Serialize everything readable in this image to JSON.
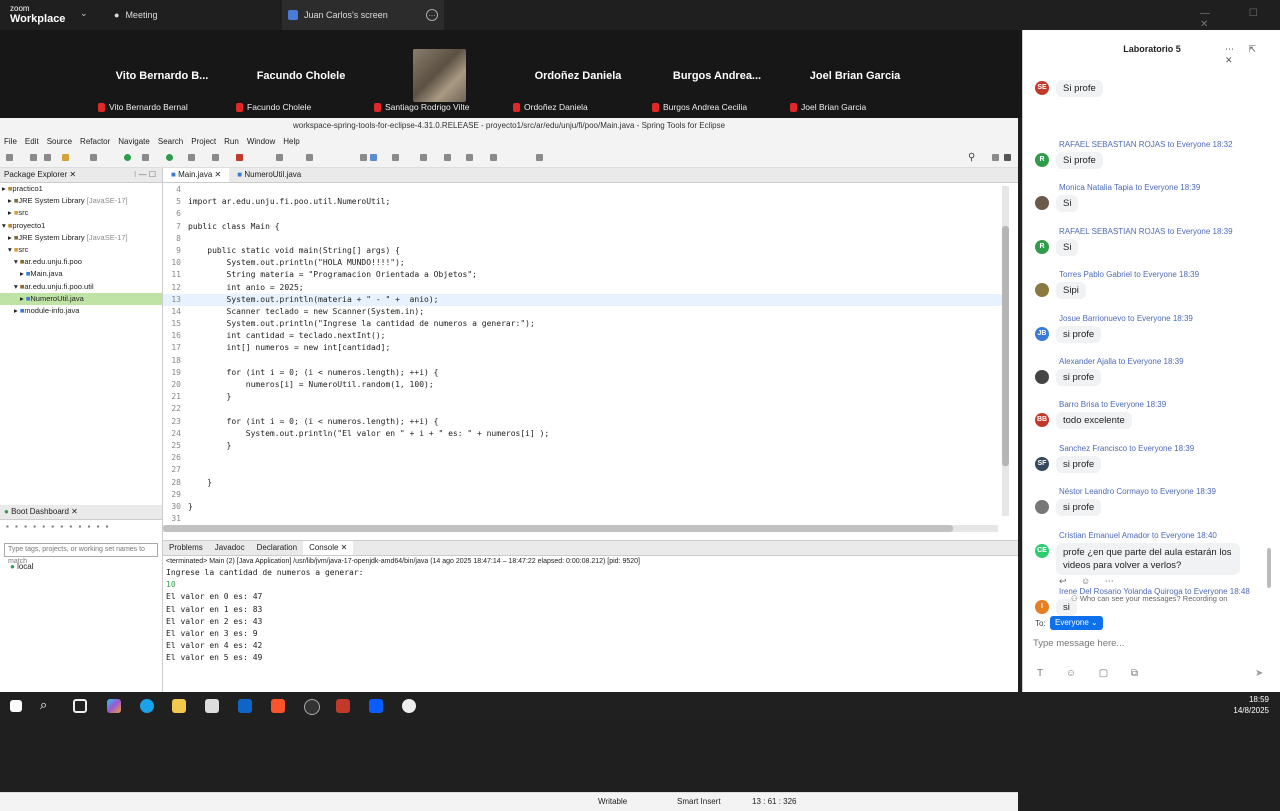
{
  "zoom": {
    "logo_top": "zoom",
    "logo_bottom": "Workplace",
    "tab_meeting": "Meeting",
    "tab_screen": "Juan Carlos's screen",
    "participants": [
      {
        "tile_name": "Vito Bernardo B...",
        "label": "Vito Bernardo Bernal"
      },
      {
        "tile_name": "Facundo Cholele",
        "label": "Facundo Cholele"
      },
      {
        "tile_name": "",
        "label": "Santiago Rodrigo Vilte"
      },
      {
        "tile_name": "Ordoñez Daniela",
        "label": "Ordoñez Daniela"
      },
      {
        "tile_name": "Burgos Andrea...",
        "label": "Burgos Andrea Cecilia"
      },
      {
        "tile_name": "Joel Brian Garcia",
        "label": "Joel Brian Garcia"
      }
    ]
  },
  "eclipse": {
    "title": "workspace-spring-tools-for-eclipse-4.31.0.RELEASE - proyecto1/src/ar/edu/unju/fi/poo/Main.java - Spring Tools for Eclipse",
    "menu": [
      "File",
      "Edit",
      "Source",
      "Refactor",
      "Navigate",
      "Search",
      "Project",
      "Run",
      "Window",
      "Help"
    ],
    "package_explorer_title": "Package Explorer",
    "tree": [
      {
        "text": "practico1",
        "indent": 0,
        "icon": "project"
      },
      {
        "text": "JRE System Library",
        "extra": "[JavaSE-17]",
        "indent": 1,
        "icon": "lib"
      },
      {
        "text": "src",
        "indent": 1,
        "icon": "folder"
      },
      {
        "text": "proyecto1",
        "indent": 0,
        "icon": "project"
      },
      {
        "text": "JRE System Library",
        "extra": "[JavaSE-17]",
        "indent": 1,
        "icon": "lib"
      },
      {
        "text": "src",
        "indent": 1,
        "icon": "folder"
      },
      {
        "text": "ar.edu.unju.fi.poo",
        "indent": 2,
        "icon": "package"
      },
      {
        "text": "Main.java",
        "indent": 3,
        "icon": "java"
      },
      {
        "text": "ar.edu.unju.fi.poo.util",
        "indent": 2,
        "icon": "package"
      },
      {
        "text": "NumeroUtil.java",
        "indent": 3,
        "icon": "java",
        "selected": true
      },
      {
        "text": "module-info.java",
        "indent": 2,
        "icon": "java"
      }
    ],
    "boot_dashboard_title": "Boot Dashboard",
    "boot_filter_placeholder": "Type tags, projects, or working set names to match",
    "boot_local": "local",
    "editor_tabs": [
      "Main.java",
      "NumeroUtil.java"
    ],
    "code_lines": [
      {
        "n": "4",
        "t": ""
      },
      {
        "n": "5",
        "t": "import ar.edu.unju.fi.poo.util.NumeroUtil;"
      },
      {
        "n": "6",
        "t": ""
      },
      {
        "n": "7",
        "t": "public class Main {"
      },
      {
        "n": "8",
        "t": ""
      },
      {
        "n": "9",
        "t": "    public static void main(String[] args) {"
      },
      {
        "n": "10",
        "t": "        System.out.println(\"HOLA MUNDO!!!!\");"
      },
      {
        "n": "11",
        "t": "        String materia = \"Programacion Orientada a Objetos\";"
      },
      {
        "n": "12",
        "t": "        int anio = 2025;"
      },
      {
        "n": "13",
        "t": "        System.out.println(materia + \" - \" +  anio);"
      },
      {
        "n": "14",
        "t": "        Scanner teclado = new Scanner(System.in);"
      },
      {
        "n": "15",
        "t": "        System.out.println(\"Ingrese la cantidad de numeros a generar:\");"
      },
      {
        "n": "16",
        "t": "        int cantidad = teclado.nextInt();"
      },
      {
        "n": "17",
        "t": "        int[] numeros = new int[cantidad];"
      },
      {
        "n": "18",
        "t": ""
      },
      {
        "n": "19",
        "t": "        for (int i = 0; (i < numeros.length); ++i) {"
      },
      {
        "n": "20",
        "t": "            numeros[i] = NumeroUtil.random(1, 100);"
      },
      {
        "n": "21",
        "t": "        }"
      },
      {
        "n": "22",
        "t": ""
      },
      {
        "n": "23",
        "t": "        for (int i = 0; (i < numeros.length); ++i) {"
      },
      {
        "n": "24",
        "t": "            System.out.println(\"El valor en \" + i + \" es: \" + numeros[i] );"
      },
      {
        "n": "25",
        "t": "        }"
      },
      {
        "n": "26",
        "t": ""
      },
      {
        "n": "27",
        "t": ""
      },
      {
        "n": "28",
        "t": "    }"
      },
      {
        "n": "29",
        "t": ""
      },
      {
        "n": "30",
        "t": "}"
      },
      {
        "n": "31",
        "t": ""
      }
    ],
    "console_tabs": [
      "Problems",
      "Javadoc",
      "Declaration",
      "Console"
    ],
    "console_header": "<terminated> Main (2) [Java Application] /usr/lib/jvm/java-17-openjdk-amd64/bin/java (14 ago 2025 18:47:14 – 18:47:22 elapsed: 0:00:08.212) [pid: 9520]",
    "console_lines": [
      "Ingrese la cantidad de numeros a generar:",
      "10",
      "El valor en 0 es: 47",
      "El valor en 1 es: 83",
      "El valor en 2 es: 43",
      "El valor en 3 es: 9",
      "El valor en 4 es: 42",
      "El valor en 5 es: 49"
    ],
    "status_writable": "Writable",
    "status_insert": "Smart Insert",
    "status_pos": "13 : 61 : 326"
  },
  "chat": {
    "title": "Laboratorio 5",
    "messages": [
      {
        "who": "",
        "text": "Si profe",
        "initials": "SE",
        "color": "#c0392b"
      },
      {
        "who": "RAFAEL SEBASTIAN ROJAS to Everyone 18:32",
        "text": "Si profe",
        "initials": "R",
        "color": "#2e9c4a"
      },
      {
        "who": "Monica Natalia Tapia to Everyone 18:39",
        "text": "Si",
        "initials": "",
        "color": "#6b5a4a"
      },
      {
        "who": "RAFAEL SEBASTIAN ROJAS to Everyone 18:39",
        "text": "Si",
        "initials": "R",
        "color": "#2e9c4a"
      },
      {
        "who": "Torres Pablo Gabriel to Everyone 18:39",
        "text": "Sipi",
        "initials": "",
        "color": "#8a7a40"
      },
      {
        "who": "Josue Barrionuevo to Everyone 18:39",
        "text": "si profe",
        "initials": "JB",
        "color": "#3a7bd5"
      },
      {
        "who": "Alexander Ajalla to Everyone 18:39",
        "text": "si profe",
        "initials": "",
        "color": "#444"
      },
      {
        "who": "Barro Brisa to Everyone 18:39",
        "text": "todo excelente",
        "initials": "BB",
        "color": "#c0392b"
      },
      {
        "who": "Sanchez Francisco to Everyone 18:39",
        "text": "si profe",
        "initials": "SF",
        "color": "#34495e"
      },
      {
        "who": "Néstor Leandro Cormayo to Everyone 18:39",
        "text": "si profe",
        "initials": "",
        "color": "#777"
      },
      {
        "who": "Cristian Emanuel Amador to Everyone 18:40",
        "text": "profe ¿en que parte del aula estarán los videos para volver a verlos?",
        "initials": "CE",
        "color": "#2ecc71"
      },
      {
        "who": "Irene Del Rosario Yolanda Quiroga to Everyone 18:48",
        "text": "si",
        "initials": "I",
        "color": "#e67e22"
      }
    ],
    "visibility_note": "Who can see your messages? Recording on",
    "to_label": "To:",
    "to_value": "Everyone ⌄",
    "input_placeholder": "Type message here..."
  },
  "taskbar": {
    "time": "18:59",
    "date": "14/8/2025"
  }
}
